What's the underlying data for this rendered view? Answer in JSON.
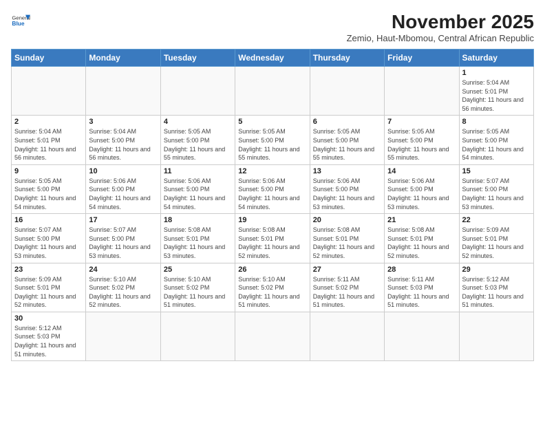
{
  "header": {
    "logo_general": "General",
    "logo_blue": "Blue",
    "month_title": "November 2025",
    "subtitle": "Zemio, Haut-Mbomou, Central African Republic"
  },
  "days_of_week": [
    "Sunday",
    "Monday",
    "Tuesday",
    "Wednesday",
    "Thursday",
    "Friday",
    "Saturday"
  ],
  "weeks": [
    [
      {
        "day": "",
        "info": ""
      },
      {
        "day": "",
        "info": ""
      },
      {
        "day": "",
        "info": ""
      },
      {
        "day": "",
        "info": ""
      },
      {
        "day": "",
        "info": ""
      },
      {
        "day": "",
        "info": ""
      },
      {
        "day": "1",
        "info": "Sunrise: 5:04 AM\nSunset: 5:01 PM\nDaylight: 11 hours and 56 minutes."
      }
    ],
    [
      {
        "day": "2",
        "info": "Sunrise: 5:04 AM\nSunset: 5:01 PM\nDaylight: 11 hours and 56 minutes."
      },
      {
        "day": "3",
        "info": "Sunrise: 5:04 AM\nSunset: 5:00 PM\nDaylight: 11 hours and 56 minutes."
      },
      {
        "day": "4",
        "info": "Sunrise: 5:05 AM\nSunset: 5:00 PM\nDaylight: 11 hours and 55 minutes."
      },
      {
        "day": "5",
        "info": "Sunrise: 5:05 AM\nSunset: 5:00 PM\nDaylight: 11 hours and 55 minutes."
      },
      {
        "day": "6",
        "info": "Sunrise: 5:05 AM\nSunset: 5:00 PM\nDaylight: 11 hours and 55 minutes."
      },
      {
        "day": "7",
        "info": "Sunrise: 5:05 AM\nSunset: 5:00 PM\nDaylight: 11 hours and 55 minutes."
      },
      {
        "day": "8",
        "info": "Sunrise: 5:05 AM\nSunset: 5:00 PM\nDaylight: 11 hours and 54 minutes."
      }
    ],
    [
      {
        "day": "9",
        "info": "Sunrise: 5:05 AM\nSunset: 5:00 PM\nDaylight: 11 hours and 54 minutes."
      },
      {
        "day": "10",
        "info": "Sunrise: 5:06 AM\nSunset: 5:00 PM\nDaylight: 11 hours and 54 minutes."
      },
      {
        "day": "11",
        "info": "Sunrise: 5:06 AM\nSunset: 5:00 PM\nDaylight: 11 hours and 54 minutes."
      },
      {
        "day": "12",
        "info": "Sunrise: 5:06 AM\nSunset: 5:00 PM\nDaylight: 11 hours and 54 minutes."
      },
      {
        "day": "13",
        "info": "Sunrise: 5:06 AM\nSunset: 5:00 PM\nDaylight: 11 hours and 53 minutes."
      },
      {
        "day": "14",
        "info": "Sunrise: 5:06 AM\nSunset: 5:00 PM\nDaylight: 11 hours and 53 minutes."
      },
      {
        "day": "15",
        "info": "Sunrise: 5:07 AM\nSunset: 5:00 PM\nDaylight: 11 hours and 53 minutes."
      }
    ],
    [
      {
        "day": "16",
        "info": "Sunrise: 5:07 AM\nSunset: 5:00 PM\nDaylight: 11 hours and 53 minutes."
      },
      {
        "day": "17",
        "info": "Sunrise: 5:07 AM\nSunset: 5:00 PM\nDaylight: 11 hours and 53 minutes."
      },
      {
        "day": "18",
        "info": "Sunrise: 5:08 AM\nSunset: 5:01 PM\nDaylight: 11 hours and 53 minutes."
      },
      {
        "day": "19",
        "info": "Sunrise: 5:08 AM\nSunset: 5:01 PM\nDaylight: 11 hours and 52 minutes."
      },
      {
        "day": "20",
        "info": "Sunrise: 5:08 AM\nSunset: 5:01 PM\nDaylight: 11 hours and 52 minutes."
      },
      {
        "day": "21",
        "info": "Sunrise: 5:08 AM\nSunset: 5:01 PM\nDaylight: 11 hours and 52 minutes."
      },
      {
        "day": "22",
        "info": "Sunrise: 5:09 AM\nSunset: 5:01 PM\nDaylight: 11 hours and 52 minutes."
      }
    ],
    [
      {
        "day": "23",
        "info": "Sunrise: 5:09 AM\nSunset: 5:01 PM\nDaylight: 11 hours and 52 minutes."
      },
      {
        "day": "24",
        "info": "Sunrise: 5:10 AM\nSunset: 5:02 PM\nDaylight: 11 hours and 52 minutes."
      },
      {
        "day": "25",
        "info": "Sunrise: 5:10 AM\nSunset: 5:02 PM\nDaylight: 11 hours and 51 minutes."
      },
      {
        "day": "26",
        "info": "Sunrise: 5:10 AM\nSunset: 5:02 PM\nDaylight: 11 hours and 51 minutes."
      },
      {
        "day": "27",
        "info": "Sunrise: 5:11 AM\nSunset: 5:02 PM\nDaylight: 11 hours and 51 minutes."
      },
      {
        "day": "28",
        "info": "Sunrise: 5:11 AM\nSunset: 5:03 PM\nDaylight: 11 hours and 51 minutes."
      },
      {
        "day": "29",
        "info": "Sunrise: 5:12 AM\nSunset: 5:03 PM\nDaylight: 11 hours and 51 minutes."
      }
    ],
    [
      {
        "day": "30",
        "info": "Sunrise: 5:12 AM\nSunset: 5:03 PM\nDaylight: 11 hours and 51 minutes."
      },
      {
        "day": "",
        "info": ""
      },
      {
        "day": "",
        "info": ""
      },
      {
        "day": "",
        "info": ""
      },
      {
        "day": "",
        "info": ""
      },
      {
        "day": "",
        "info": ""
      },
      {
        "day": "",
        "info": ""
      }
    ]
  ]
}
